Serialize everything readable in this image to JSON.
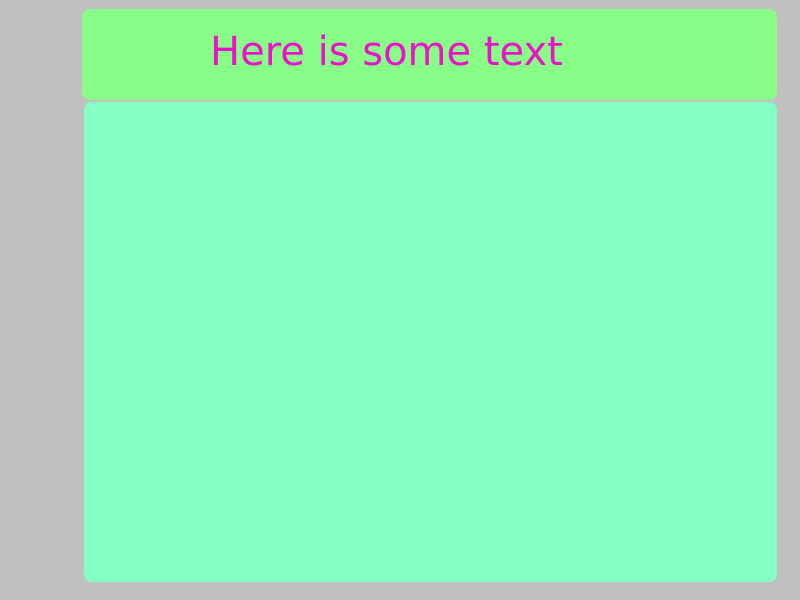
{
  "header": {
    "text": "Here is some text"
  },
  "colors": {
    "background": "#c0c0c0",
    "header_panel": "#88fd88",
    "content_panel": "#84ffc6",
    "text": "#ee11cc"
  }
}
